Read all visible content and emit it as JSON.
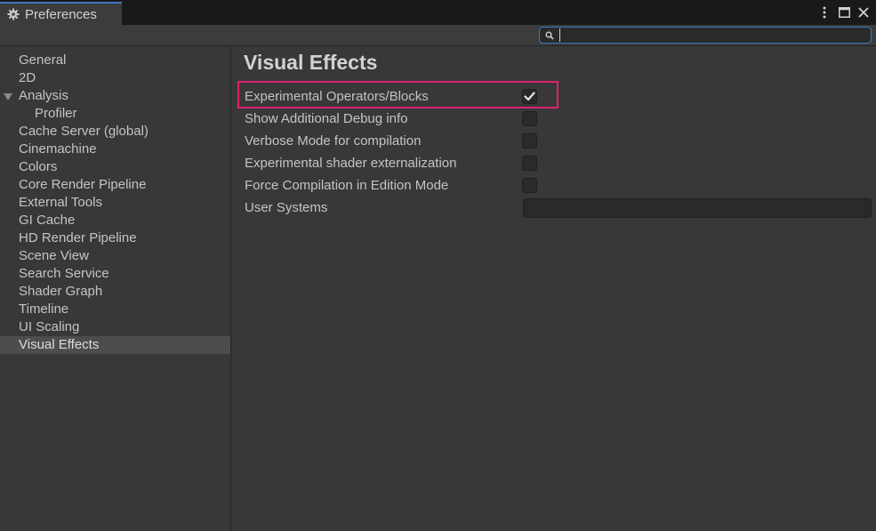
{
  "window": {
    "tab_label": "Preferences",
    "tab_icon": "gear-icon",
    "controls": [
      "more-options-icon",
      "maximize-icon",
      "close-icon"
    ]
  },
  "search": {
    "value": "",
    "placeholder": ""
  },
  "sidebar": {
    "items": [
      {
        "label": "General"
      },
      {
        "label": "2D"
      },
      {
        "label": "Analysis",
        "expanded": true
      },
      {
        "label": "Profiler",
        "child": true
      },
      {
        "label": "Cache Server (global)"
      },
      {
        "label": "Cinemachine"
      },
      {
        "label": "Colors"
      },
      {
        "label": "Core Render Pipeline"
      },
      {
        "label": "External Tools"
      },
      {
        "label": "GI Cache"
      },
      {
        "label": "HD Render Pipeline"
      },
      {
        "label": "Scene View"
      },
      {
        "label": "Search Service"
      },
      {
        "label": "Shader Graph"
      },
      {
        "label": "Timeline"
      },
      {
        "label": "UI Scaling"
      },
      {
        "label": "Visual Effects",
        "selected": true
      }
    ]
  },
  "main": {
    "title": "Visual Effects",
    "settings": [
      {
        "label": "Experimental Operators/Blocks",
        "type": "checkbox",
        "checked": true,
        "highlighted": true
      },
      {
        "label": "Show Additional Debug info",
        "type": "checkbox",
        "checked": false
      },
      {
        "label": "Verbose Mode for compilation",
        "type": "checkbox",
        "checked": false
      },
      {
        "label": "Experimental shader externalization",
        "type": "checkbox",
        "checked": false
      },
      {
        "label": "Force Compilation in Edition Mode",
        "type": "checkbox",
        "checked": false
      },
      {
        "label": "User Systems",
        "type": "text",
        "value": ""
      }
    ]
  },
  "colors": {
    "accent": "#3a79bb",
    "highlight": "#e0226e",
    "selected_row": "#4d4d4d"
  }
}
